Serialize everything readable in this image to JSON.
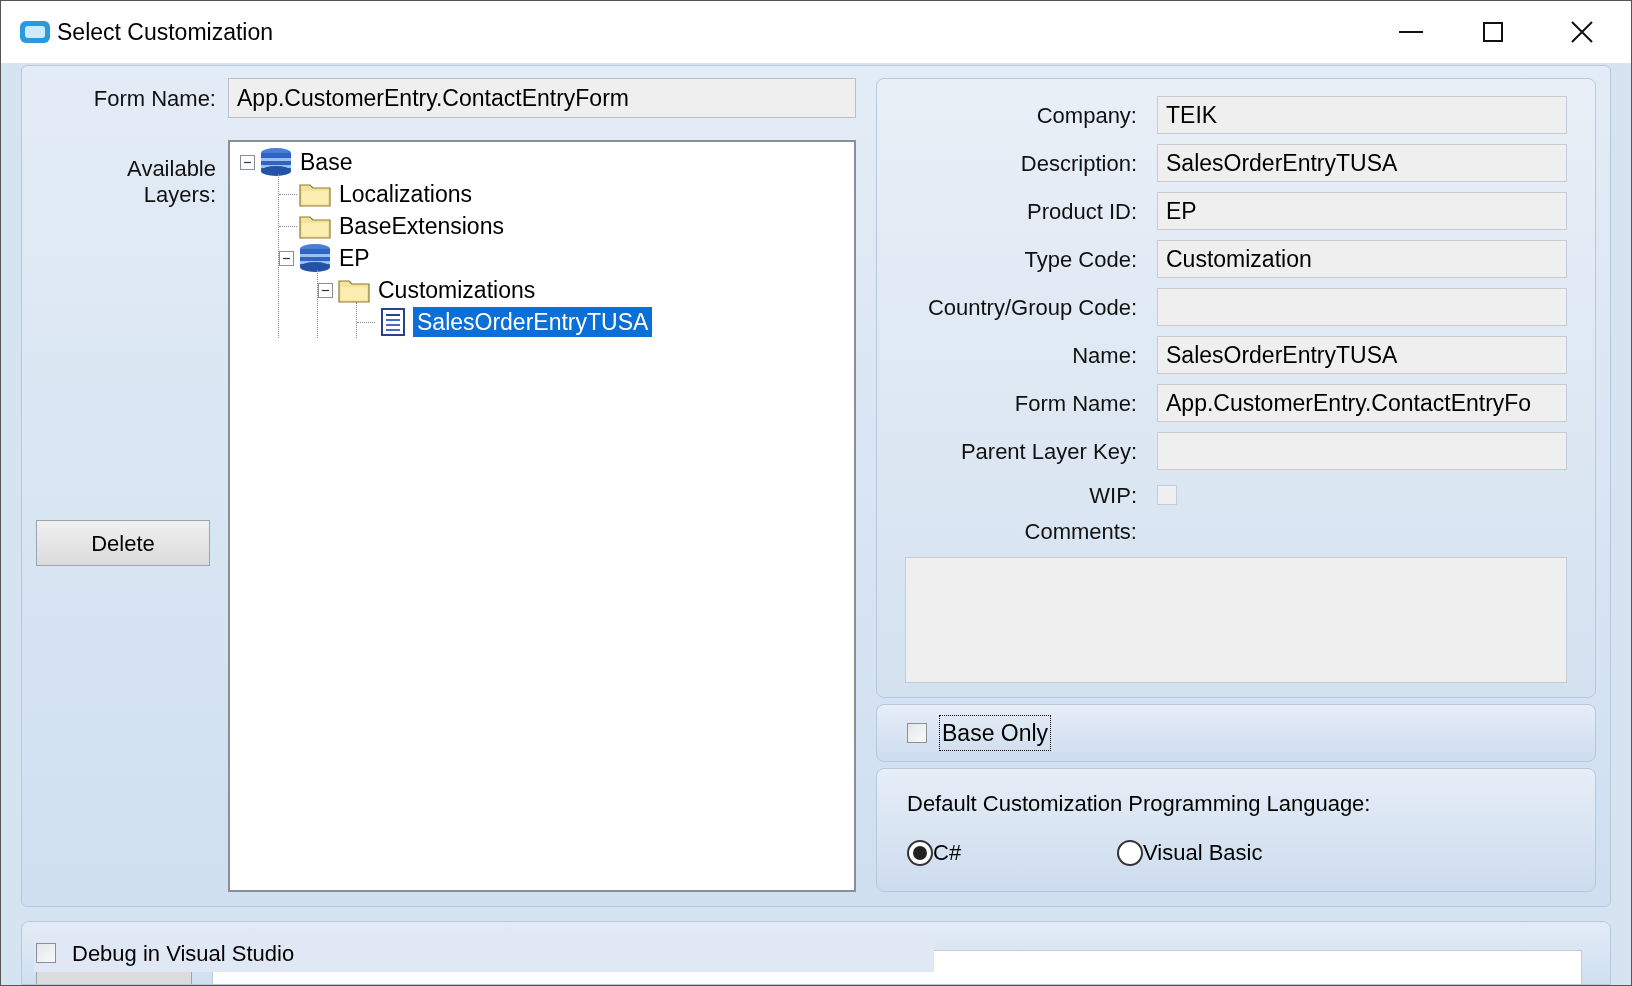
{
  "window": {
    "title": "Select Customization"
  },
  "form_name": {
    "label": "Form Name:",
    "value": "App.CustomerEntry.ContactEntryForm"
  },
  "layers_label": "Available Layers:",
  "tree": [
    {
      "label": "Base",
      "kind": "database",
      "expanded": true,
      "selected": false,
      "children": [
        {
          "label": "Localizations",
          "kind": "folder",
          "selected": false
        },
        {
          "label": "BaseExtensions",
          "kind": "folder",
          "selected": false
        },
        {
          "label": "EP",
          "kind": "database",
          "expanded": true,
          "selected": false,
          "children": [
            {
              "label": "Customizations",
              "kind": "folder",
              "expanded": true,
              "selected": false,
              "children": [
                {
                  "label": "SalesOrderEntryTUSA",
                  "kind": "document",
                  "selected": true
                }
              ]
            }
          ]
        }
      ]
    }
  ],
  "delete_button": "Delete",
  "details": [
    {
      "label": "Company:",
      "kind": "text",
      "value": "TEIK"
    },
    {
      "label": "Description:",
      "kind": "text",
      "value": "SalesOrderEntryTUSA"
    },
    {
      "label": "Product ID:",
      "kind": "text",
      "value": "EP"
    },
    {
      "label": "Type Code:",
      "kind": "text",
      "value": "Customization"
    },
    {
      "label": "Country/Group Code:",
      "kind": "text"
    },
    {
      "label": "Name:",
      "kind": "text",
      "value": "SalesOrderEntryTUSA"
    },
    {
      "label": "Form Name:",
      "kind": "text",
      "value": "App.CustomerEntry.ContactEntryFo"
    },
    {
      "label": "Parent Layer Key:",
      "kind": "text"
    },
    {
      "label": "WIP:",
      "kind": "checkbox",
      "checked": false,
      "disabled": true
    }
  ],
  "comments": {
    "label": "Comments:"
  },
  "base_only": {
    "label": "Base Only",
    "checked": false
  },
  "language": {
    "label": "Default Customization Programming Language:",
    "options": [
      {
        "label": "C#",
        "selected": true
      },
      {
        "label": "Visual Basic",
        "selected": false
      }
    ]
  },
  "debug": {
    "label": "Debug in Visual Studio",
    "checked": false
  }
}
